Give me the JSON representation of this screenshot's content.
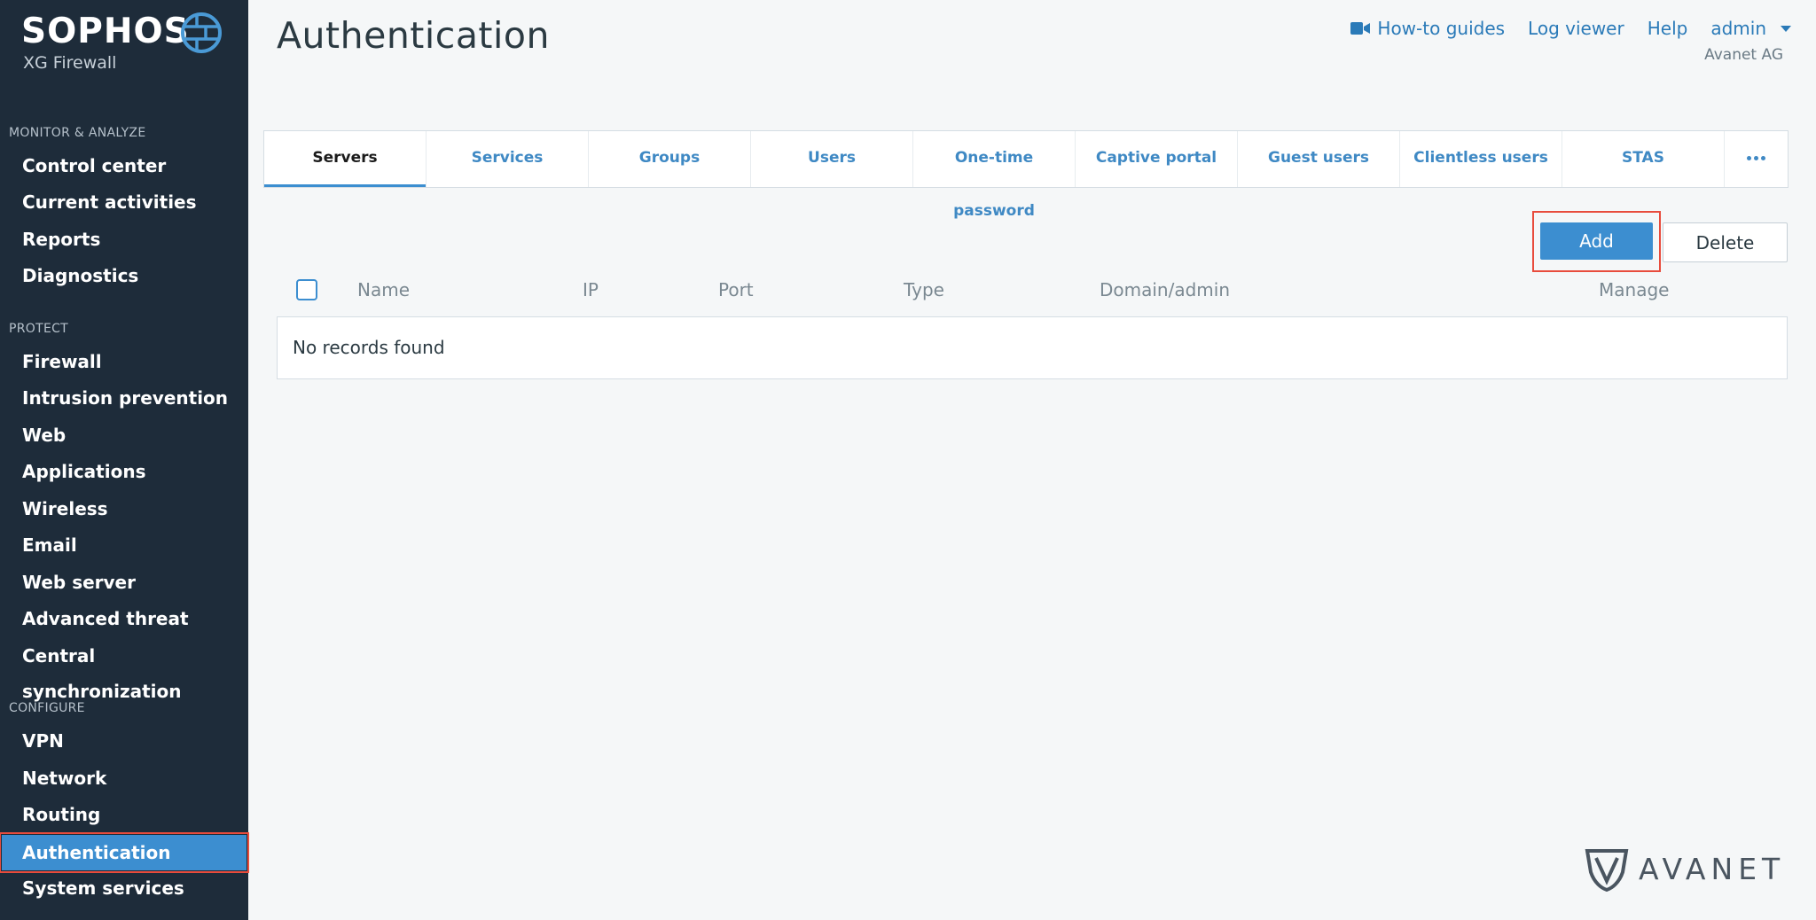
{
  "brand": {
    "name": "SOPHOS",
    "product": "XG Firewall",
    "logo_icon": "globe-icon"
  },
  "sidebar": {
    "sections": [
      {
        "title": "MONITOR & ANALYZE",
        "items": [
          "Control center",
          "Current activities",
          "Reports",
          "Diagnostics"
        ]
      },
      {
        "title": "PROTECT",
        "items": [
          "Firewall",
          "Intrusion prevention",
          "Web",
          "Applications",
          "Wireless",
          "Email",
          "Web server",
          "Advanced threat",
          "Central synchronization"
        ]
      },
      {
        "title": "CONFIGURE",
        "items": [
          "VPN",
          "Network",
          "Routing",
          "Authentication",
          "System services"
        ]
      }
    ],
    "active_item": "Authentication"
  },
  "header": {
    "title": "Authentication",
    "links": {
      "howto": "How-to guides",
      "log_viewer": "Log viewer",
      "help": "Help",
      "user": "admin"
    },
    "organization": "Avanet AG"
  },
  "tabs": {
    "items": [
      "Servers",
      "Services",
      "Groups",
      "Users",
      "One-time password",
      "Captive portal",
      "Guest users",
      "Clientless users",
      "STAS"
    ],
    "active": "Servers",
    "more_icon": "more-dots-icon"
  },
  "toolbar": {
    "add_label": "Add",
    "delete_label": "Delete"
  },
  "table": {
    "columns": [
      "Name",
      "IP",
      "Port",
      "Type",
      "Domain/admin",
      "Manage"
    ],
    "empty_message": "No records found"
  },
  "watermark": {
    "text": "AVANET"
  },
  "colors": {
    "sidebar_bg": "#1e2c3a",
    "accent": "#3c8ed0",
    "highlight": "#e84c3d",
    "link": "#2a7ab8"
  }
}
